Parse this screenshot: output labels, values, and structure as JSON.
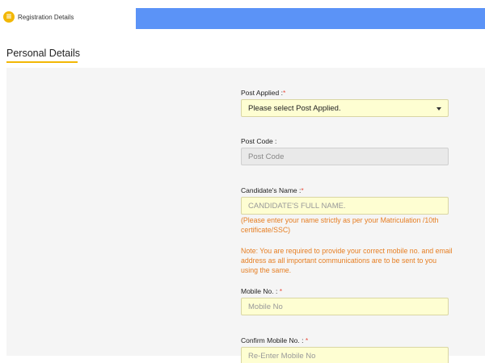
{
  "header": {
    "tab_icon": "list-icon",
    "tab_label": "Registration Details",
    "accent_color": "#5b93f7"
  },
  "section": {
    "title": "Personal Details"
  },
  "form": {
    "post_applied": {
      "label": "Post Applied :",
      "required": "*",
      "selected": "Please select Post Applied."
    },
    "post_code": {
      "label": "Post Code :",
      "placeholder": "Post Code"
    },
    "candidate_name": {
      "label": "Candidate's Name :",
      "required": "*",
      "placeholder": "CANDIDATE'S FULL NAME.",
      "hint": "(Please enter your name strictly as per your Matriculation /10th certificate/SSC)"
    },
    "note": "Note: You are required to provide your correct mobile no. and email address as all important communications are to be sent to you using the same.",
    "mobile": {
      "label": "Mobile No. :",
      "required": "*",
      "placeholder": "Mobile No"
    },
    "confirm_mobile": {
      "label": "Confirm Mobile No. :",
      "required": "*",
      "placeholder": "Re-Enter Mobile No"
    }
  }
}
